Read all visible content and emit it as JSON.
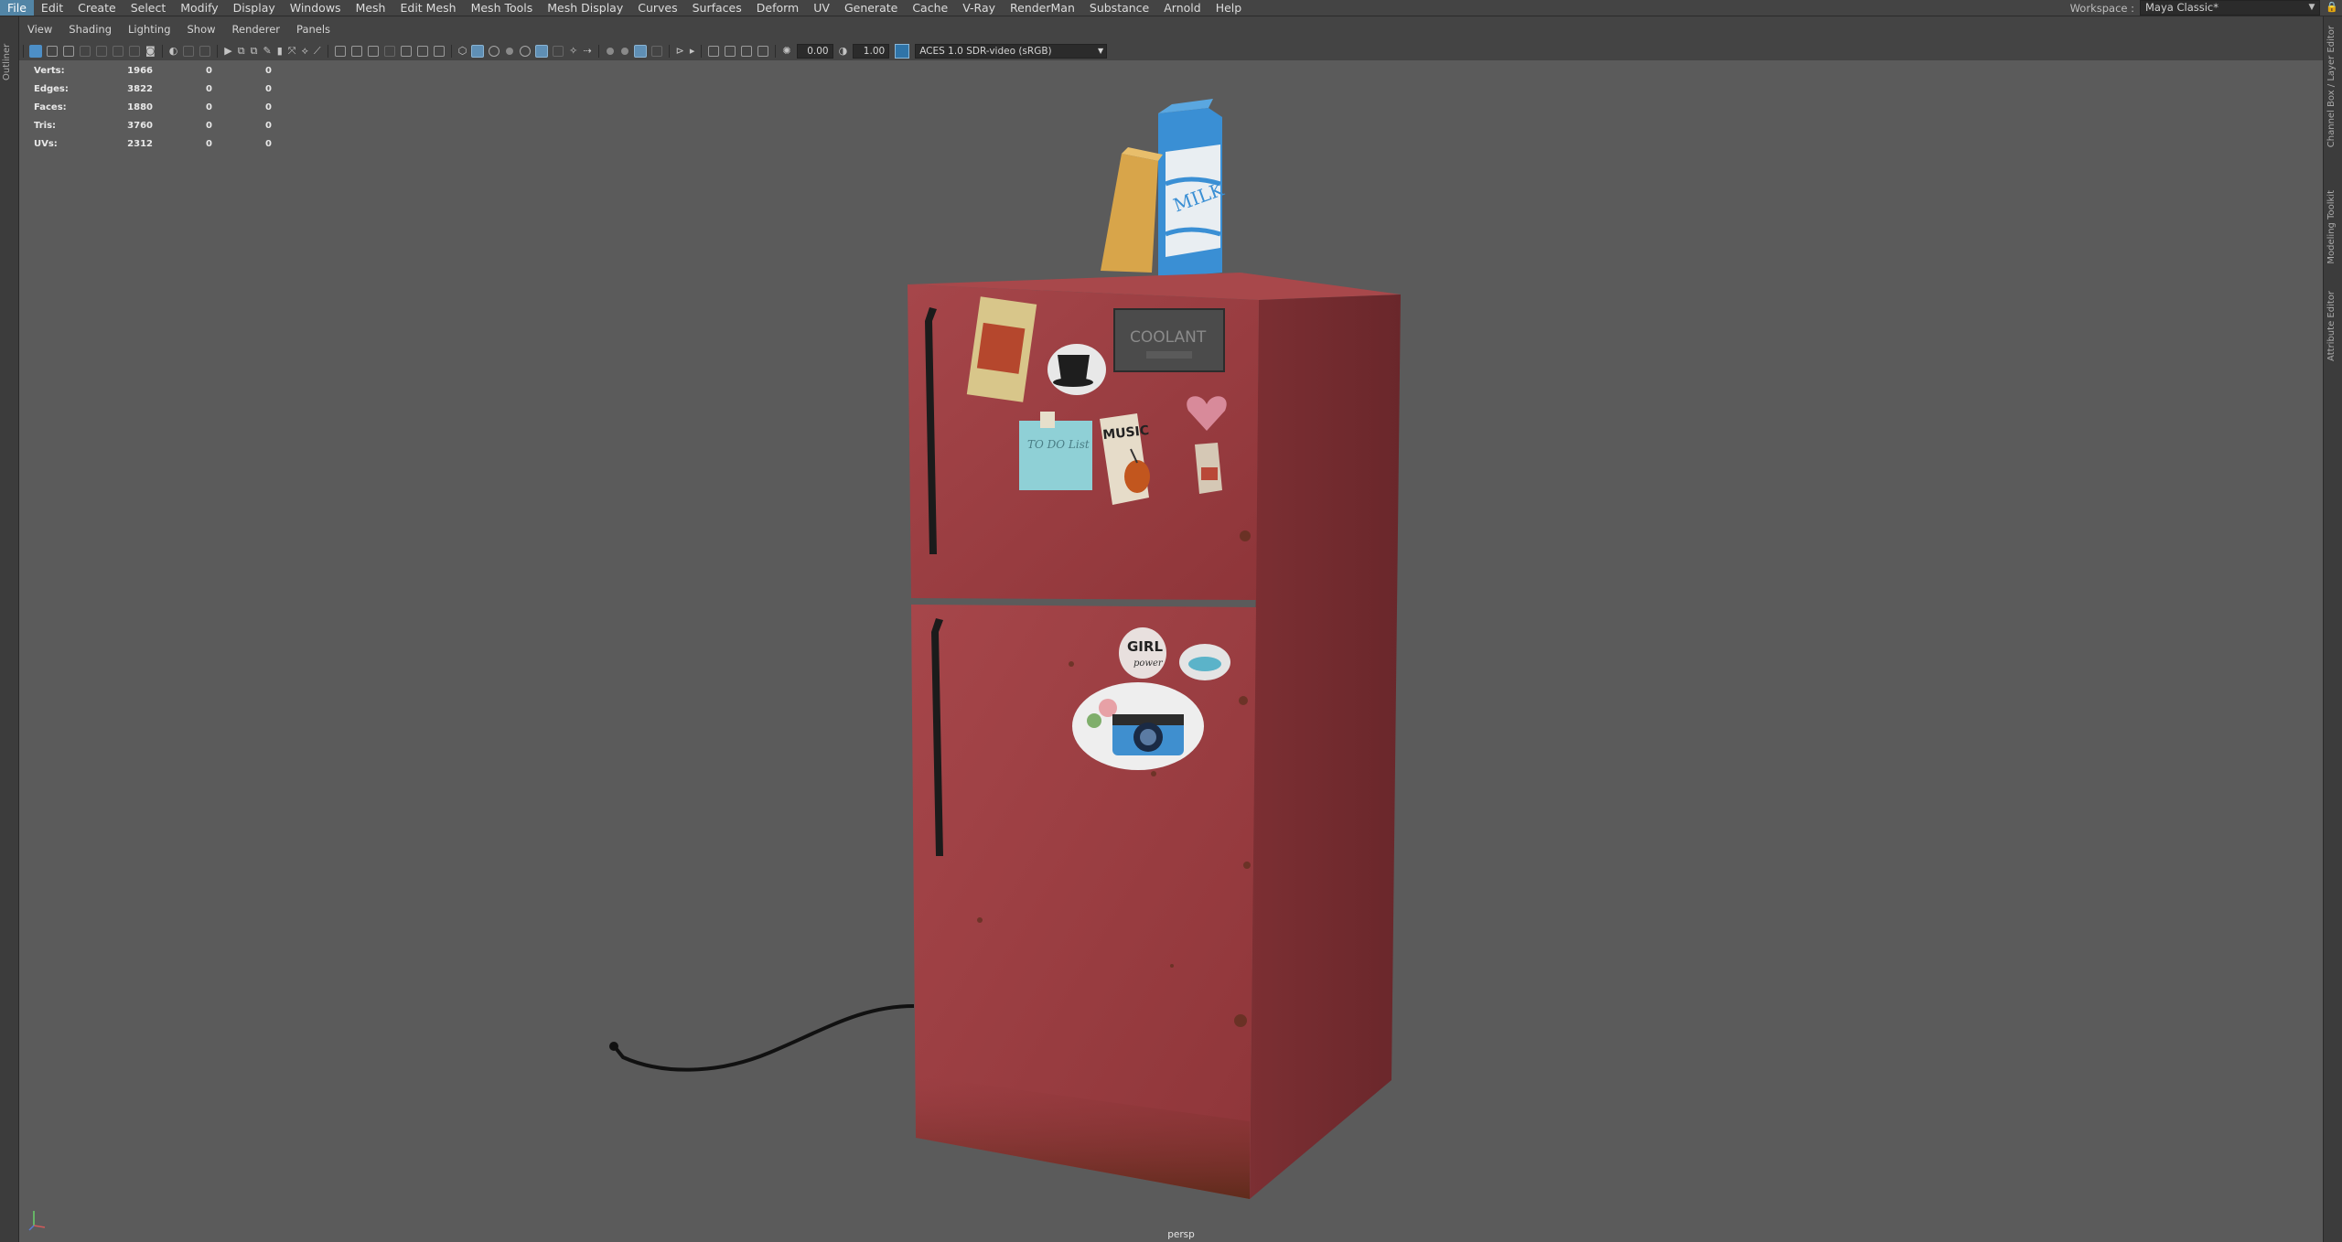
{
  "menubar": {
    "items": [
      "File",
      "Edit",
      "Create",
      "Select",
      "Modify",
      "Display",
      "Windows",
      "Mesh",
      "Edit Mesh",
      "Mesh Tools",
      "Mesh Display",
      "Curves",
      "Surfaces",
      "Deform",
      "UV",
      "Generate",
      "Cache",
      "V-Ray",
      "RenderMan",
      "Substance",
      "Arnold",
      "Help"
    ],
    "active": "File"
  },
  "workspace": {
    "label": "Workspace :",
    "value": "Maya Classic*"
  },
  "left_tabs": {
    "outliner": "Outliner"
  },
  "right_tabs": {
    "channel_box": "Channel Box / Layer Editor",
    "modeling_toolkit": "Modeling Toolkit",
    "attribute_editor": "Attribute Editor"
  },
  "panel_menu": [
    "View",
    "Shading",
    "Lighting",
    "Show",
    "Renderer",
    "Panels"
  ],
  "toolbar": {
    "exposure": "0.00",
    "gamma": "1.00",
    "color_space": "ACES 1.0 SDR-video (sRGB)"
  },
  "hud": {
    "rows": [
      {
        "label": "Verts:",
        "v1": "1966",
        "v2": "0",
        "v3": "0"
      },
      {
        "label": "Edges:",
        "v1": "3822",
        "v2": "0",
        "v3": "0"
      },
      {
        "label": "Faces:",
        "v1": "1880",
        "v2": "0",
        "v3": "0"
      },
      {
        "label": "Tris:",
        "v1": "3760",
        "v2": "0",
        "v3": "0"
      },
      {
        "label": "UVs:",
        "v1": "2312",
        "v2": "0",
        "v3": "0"
      }
    ]
  },
  "viewport": {
    "camera": "persp"
  },
  "scene": {
    "coolant_label": "COOLANT",
    "milk_label": "MILK",
    "todo_label": "TO DO List",
    "music_label": "MUSIC",
    "girl_label": "GIRL",
    "power_label": "power"
  },
  "colors": {
    "menu_active": "#5285a6",
    "viewport_bg": "#5b5b5b",
    "fridge_red": "#9c3a3e",
    "milk_blue": "#3a8fd4"
  }
}
